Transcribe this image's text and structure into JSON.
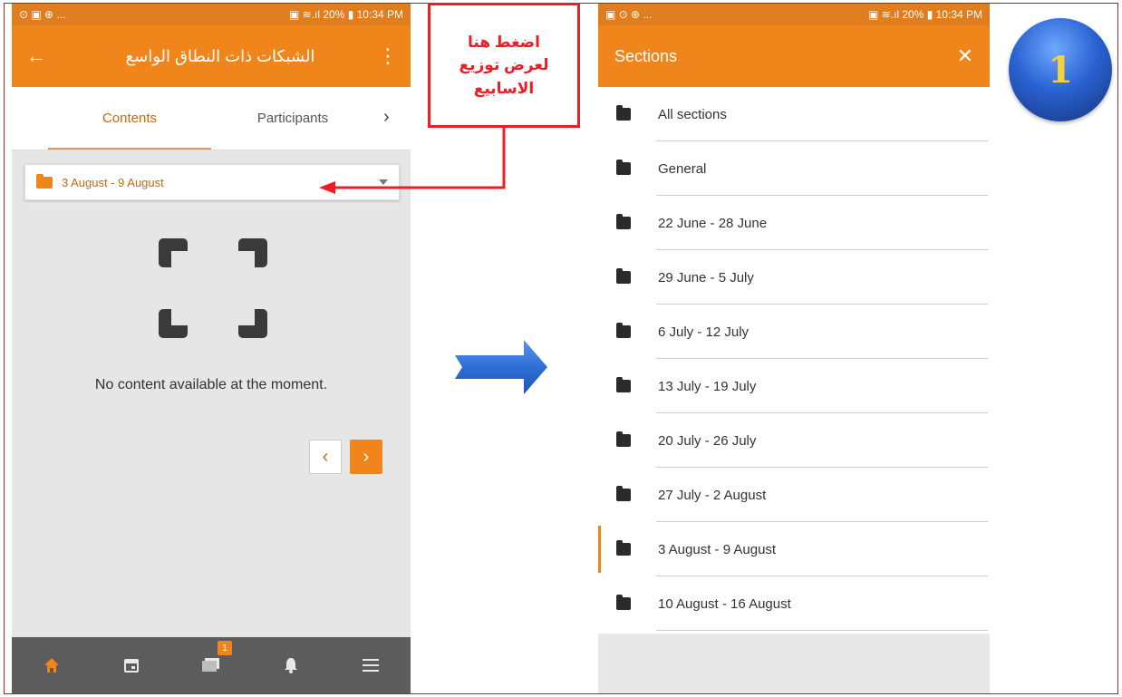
{
  "left_phone": {
    "statusbar": {
      "left": "⊙ ▣ ⊕ ...",
      "right": "▣ ≋.ıl 20% ▮ 10:34 PM"
    },
    "appbar": {
      "back": "←",
      "title": "الشبكات ذات النطاق الواسع",
      "more": "⋮"
    },
    "tabs": [
      {
        "label": "Contents",
        "active": true
      },
      {
        "label": "Participants",
        "active": false
      }
    ],
    "tabs_next": "›",
    "section_select": {
      "label": "3 August - 9 August"
    },
    "empty_message": "No content available at the moment.",
    "nav": {
      "prev": "‹",
      "next": "›"
    },
    "bottom_nav": {
      "badge": "1"
    }
  },
  "callout": {
    "line1": "اضغط هنا",
    "line2": "لعرض توزيع",
    "line3": "الاسابيع"
  },
  "right_phone": {
    "statusbar": {
      "left": "▣ ⊙ ⊕ ...",
      "right": "▣ ≋.ıl 20% ▮ 10:34 PM"
    },
    "appbar": {
      "title": "Sections",
      "close": "✕"
    },
    "sections": [
      "All sections",
      "General",
      "22 June - 28 June",
      "29 June - 5 July",
      "6 July - 12 July",
      "13 July - 19 July",
      "20 July - 26 July",
      "27 July - 2 August",
      "3 August - 9 August",
      "10 August - 16 August"
    ],
    "selected_index": 8
  },
  "step_number": "1",
  "colors": {
    "accent": "#f0851c",
    "callout_red": "#ee1c24",
    "arrow_blue": "#2f6fd6"
  }
}
